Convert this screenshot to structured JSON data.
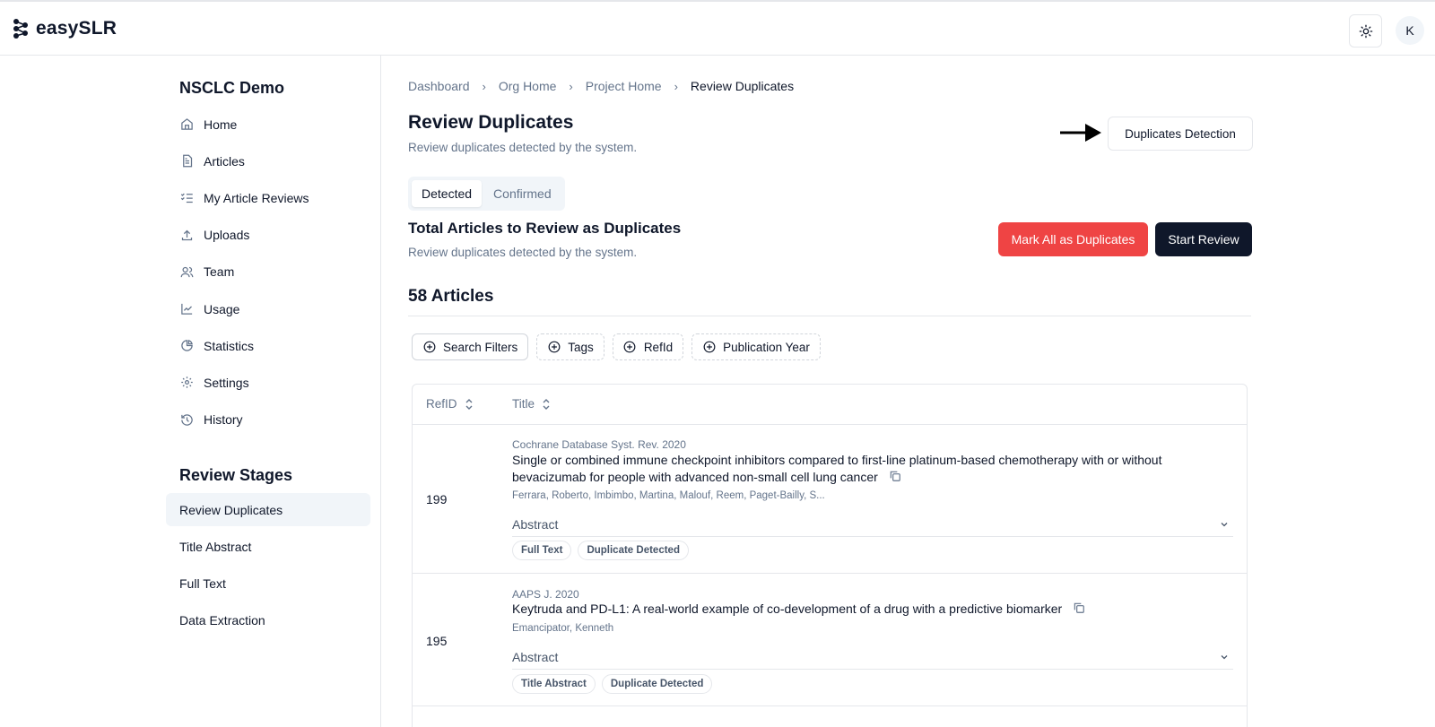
{
  "app": {
    "name": "easySLR",
    "avatar_initial": "K"
  },
  "sidebar": {
    "project_title": "NSCLC Demo",
    "items": [
      {
        "label": "Home",
        "icon": "home-icon"
      },
      {
        "label": "Articles",
        "icon": "file-text-icon"
      },
      {
        "label": "My Article Reviews",
        "icon": "list-check-icon"
      },
      {
        "label": "Uploads",
        "icon": "upload-icon"
      },
      {
        "label": "Team",
        "icon": "users-icon"
      },
      {
        "label": "Usage",
        "icon": "line-chart-icon"
      },
      {
        "label": "Statistics",
        "icon": "pie-chart-icon"
      },
      {
        "label": "Settings",
        "icon": "gear-icon"
      },
      {
        "label": "History",
        "icon": "history-icon"
      }
    ],
    "stages_title": "Review Stages",
    "stages": [
      {
        "label": "Review Duplicates",
        "active": true
      },
      {
        "label": "Title Abstract",
        "active": false
      },
      {
        "label": "Full Text",
        "active": false
      },
      {
        "label": "Data Extraction",
        "active": false
      }
    ]
  },
  "breadcrumb": [
    "Dashboard",
    "Org Home",
    "Project Home",
    "Review Duplicates"
  ],
  "header": {
    "title": "Review Duplicates",
    "subtitle": "Review duplicates detected by the system.",
    "detection_button": "Duplicates Detection"
  },
  "tabs": [
    {
      "label": "Detected",
      "active": true
    },
    {
      "label": "Confirmed",
      "active": false
    }
  ],
  "section": {
    "title": "Total Articles to Review as Duplicates",
    "subtitle": "Review duplicates detected by the system.",
    "mark_all_button": "Mark All as Duplicates",
    "start_review_button": "Start Review",
    "count_label": "58 Articles"
  },
  "filters": [
    "Search Filters",
    "Tags",
    "RefId",
    "Publication Year"
  ],
  "table": {
    "columns": [
      "RefID",
      "Title"
    ],
    "rows": [
      {
        "refid": "199",
        "journal": "Cochrane Database Syst. Rev. 2020",
        "title": "Single or combined immune checkpoint inhibitors compared to first-line platinum-based chemotherapy with or without bevacizumab for people with advanced non-small cell lung cancer",
        "authors": "Ferrara, Roberto, Imbimbo, Martina, Malouf, Reem, Paget-Bailly, S...",
        "abstract_label": "Abstract",
        "badges": [
          "Full Text",
          "Duplicate Detected"
        ]
      },
      {
        "refid": "195",
        "journal": "AAPS J. 2020",
        "title": "Keytruda and PD-L1: A real-world example of co-development of a drug with a predictive biomarker",
        "authors": "Emancipator, Kenneth",
        "abstract_label": "Abstract",
        "badges": [
          "Title Abstract",
          "Duplicate Detected"
        ]
      }
    ]
  },
  "colors": {
    "danger": "#ef4444",
    "primary": "#0f172a",
    "muted": "#64748b",
    "border": "#e5e7eb"
  }
}
